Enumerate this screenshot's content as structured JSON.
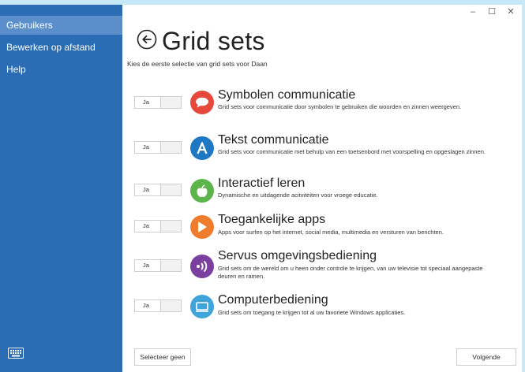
{
  "sidebar": {
    "items": [
      {
        "label": "Gebruikers"
      },
      {
        "label": "Bewerken op afstand"
      },
      {
        "label": "Help"
      }
    ],
    "keyboard_icon": "keyboard-icon"
  },
  "window": {
    "minimize": "–",
    "maximize": "☐",
    "close": "✕"
  },
  "header": {
    "back_icon": "back-arrow-icon",
    "title": "Grid sets",
    "subtitle": "Kies de eerste selectie van grid sets voor Daan"
  },
  "grid_sets": [
    {
      "toggle_label": "Ja",
      "title": "Symbolen communicatie",
      "description": "Grid sets voor communicatie door symbolen te gebruiken die woorden en zinnen weergeven.",
      "icon": "speech-bubble-icon",
      "color": "#e8473c"
    },
    {
      "toggle_label": "Ja",
      "title": "Tekst communicatie",
      "description": "Grid sets voor communicatie met behulp van een toetsenbord met voorspelling en opgeslagen zinnen.",
      "icon": "letter-a-icon",
      "color": "#1f78c4"
    },
    {
      "toggle_label": "Ja",
      "title": "Interactief leren",
      "description": "Dynamische en uitdagende acitviteiten voor vroege educatie.",
      "icon": "apple-icon",
      "color": "#5cb54a"
    },
    {
      "toggle_label": "Ja",
      "title": "Toegankelijke apps",
      "description": "Apps voor surfen op het internet, social media, multimedia en versturen van berichten.",
      "icon": "play-icon",
      "color": "#f07d2e"
    },
    {
      "toggle_label": "Ja",
      "title": "Servus omgevingsbediening",
      "description": "Grid sets om de wereld om u heen onder controle te krijgen, van uw televisie tot speciaal aangepaste deuren en ramen.",
      "icon": "signal-icon",
      "color": "#7b3fa0"
    },
    {
      "toggle_label": "Ja",
      "title": "Computerbediening",
      "description": "Grid sets om toegang te krijgen tot al uw favoriete Windows applicaties.",
      "icon": "monitor-icon",
      "color": "#3ea4d9"
    }
  ],
  "footer": {
    "select_none": "Selecteer geen",
    "next": "Volgende"
  }
}
